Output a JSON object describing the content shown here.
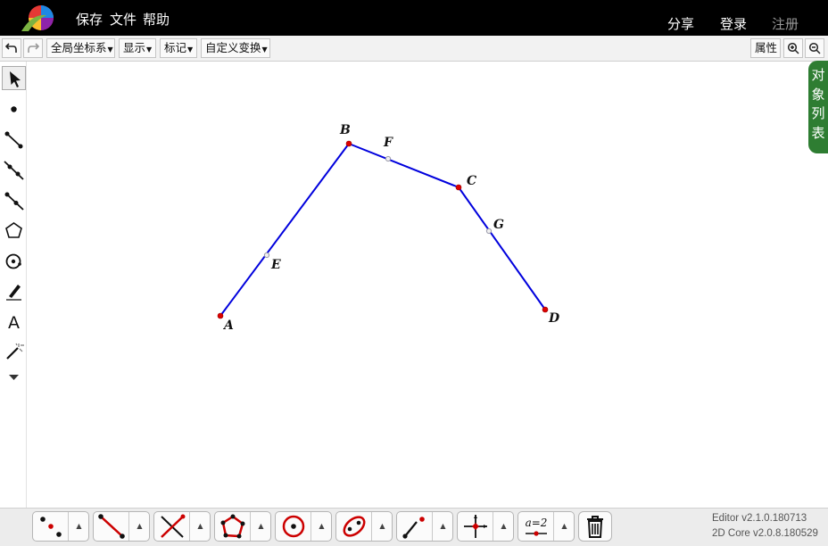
{
  "menu": {
    "save": "保存",
    "file": "文件",
    "help": "帮助"
  },
  "account": {
    "share": "分享",
    "login": "登录",
    "register": "注册"
  },
  "toolbar": {
    "undo_icon": "undo-icon",
    "redo_icon": "redo-icon",
    "coord_system": "全局坐标系",
    "show": "显示",
    "mark": "标记",
    "custom_transform": "自定义变换",
    "properties": "属性",
    "zoom_in_icon": "zoom-in-icon",
    "zoom_out_icon": "zoom-out-icon"
  },
  "side_panel": {
    "object_list": "对象列表"
  },
  "left_tools": [
    "move-icon",
    "point-icon",
    "segment-icon",
    "line-icon",
    "ray-icon",
    "polygon-icon",
    "circle-icon",
    "pen-icon",
    "text-icon",
    "magic-wand-icon",
    "more-icon"
  ],
  "text_tool_label": "A",
  "canvas": {
    "line_color": "#0000dd",
    "point_color": "#dd0000",
    "points": [
      {
        "label": "A"
      },
      {
        "label": "B"
      },
      {
        "label": "C"
      },
      {
        "label": "D"
      },
      {
        "label": "E"
      },
      {
        "label": "F"
      },
      {
        "label": "G"
      }
    ]
  },
  "bottom_tools": [
    "points-tool",
    "segment-tool",
    "intersect-tool",
    "polygon-tool",
    "circle-tool",
    "conic-tool",
    "ray-tool",
    "transform-tool",
    "measure-tool"
  ],
  "measure_label": "a=2",
  "version": {
    "editor": "Editor v2.1.0.180713",
    "core": "2D Core v2.0.8.180529"
  }
}
